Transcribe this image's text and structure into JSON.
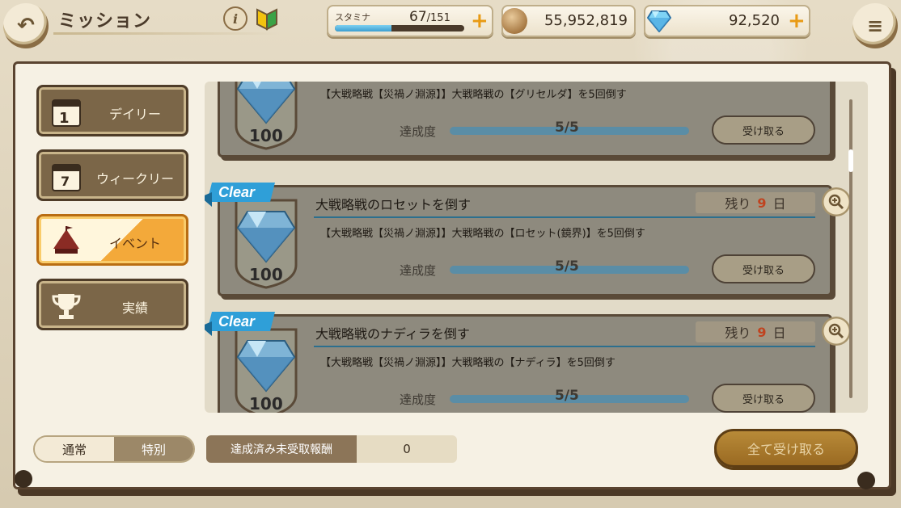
{
  "header": {
    "title": "ミッション",
    "stamina_label": "スタミナ",
    "stamina_current": "67",
    "stamina_max": "/151",
    "stamina_fraction": 0.44,
    "coins": "55,952,819",
    "gems": "92,520"
  },
  "sidebar": {
    "items": [
      {
        "label": "デイリー",
        "icon": "daily-calendar-icon"
      },
      {
        "label": "ウィークリー",
        "icon": "weekly-calendar-icon"
      },
      {
        "label": "イベント",
        "icon": "event-tent-icon",
        "active": true
      },
      {
        "label": "実績",
        "icon": "trophy-icon"
      }
    ]
  },
  "missions": [
    {
      "title": "",
      "desc": "【大戦略戦【災禍ノ淵源】】大戦略戦の【グリセルダ】を5回倒す",
      "reward": "100",
      "progress_label": "達成度",
      "progress_text": "5/5",
      "progress_fraction": 1.0,
      "claim_label": "受け取る"
    },
    {
      "title": "大戦略戦のロセットを倒す",
      "desc": "【大戦略戦【災禍ノ淵源】】大戦略戦の【ロセット(鏡界)】を5回倒す",
      "reward": "100",
      "remain_prefix": "残り",
      "remain_num": "9",
      "remain_unit": "日",
      "clear_label": "Clear",
      "progress_label": "達成度",
      "progress_text": "5/5",
      "progress_fraction": 1.0,
      "claim_label": "受け取る"
    },
    {
      "title": "大戦略戦のナディラを倒す",
      "desc": "【大戦略戦【災禍ノ淵源】】大戦略戦の【ナディラ】を5回倒す",
      "reward": "100",
      "remain_prefix": "残り",
      "remain_num": "9",
      "remain_unit": "日",
      "clear_label": "Clear",
      "progress_label": "達成度",
      "progress_text": "5/5",
      "progress_fraction": 1.0,
      "claim_label": "受け取る"
    }
  ],
  "bottom": {
    "toggle_normal": "通常",
    "toggle_special": "特別",
    "unclaimed_label": "達成済み未受取報酬",
    "unclaimed_value": "0",
    "claim_all_label": "全て受け取る"
  },
  "colors": {
    "accent": "#f3a93a",
    "clear_tag": "#2f9fd8",
    "remain_number": "#c0431f"
  }
}
